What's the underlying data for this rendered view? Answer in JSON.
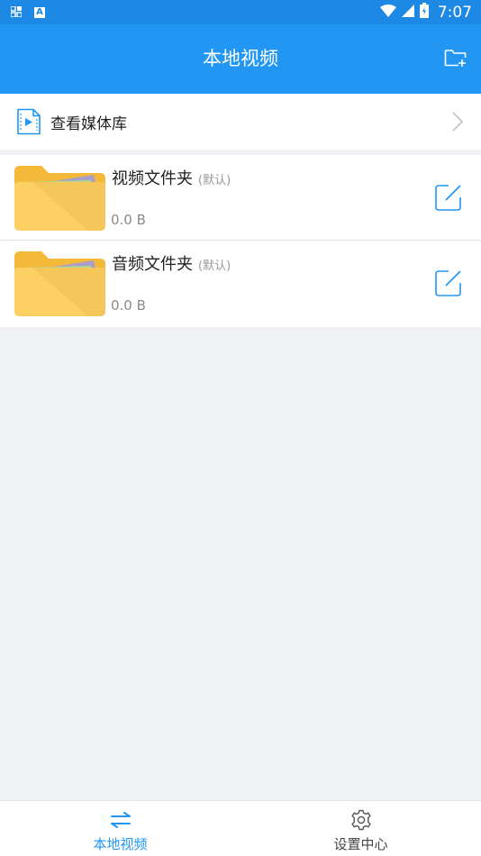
{
  "status_bar": {
    "time": "7:07",
    "badge_letter": "A"
  },
  "app_bar": {
    "title": "本地视频"
  },
  "media_library": {
    "label": "查看媒体库"
  },
  "folders": [
    {
      "name": "视频文件夹",
      "tag": "(默认)",
      "size": "0.0 B"
    },
    {
      "name": "音频文件夹",
      "tag": "(默认)",
      "size": "0.0 B"
    }
  ],
  "bottom_nav": [
    {
      "label": "本地视频",
      "icon": "swap-arrows-icon",
      "active": true
    },
    {
      "label": "设置中心",
      "icon": "gear-icon",
      "active": false
    }
  ],
  "colors": {
    "primary": "#2196f3",
    "status_bar": "#1e88e5",
    "folder_yellow": "#fdd063"
  }
}
